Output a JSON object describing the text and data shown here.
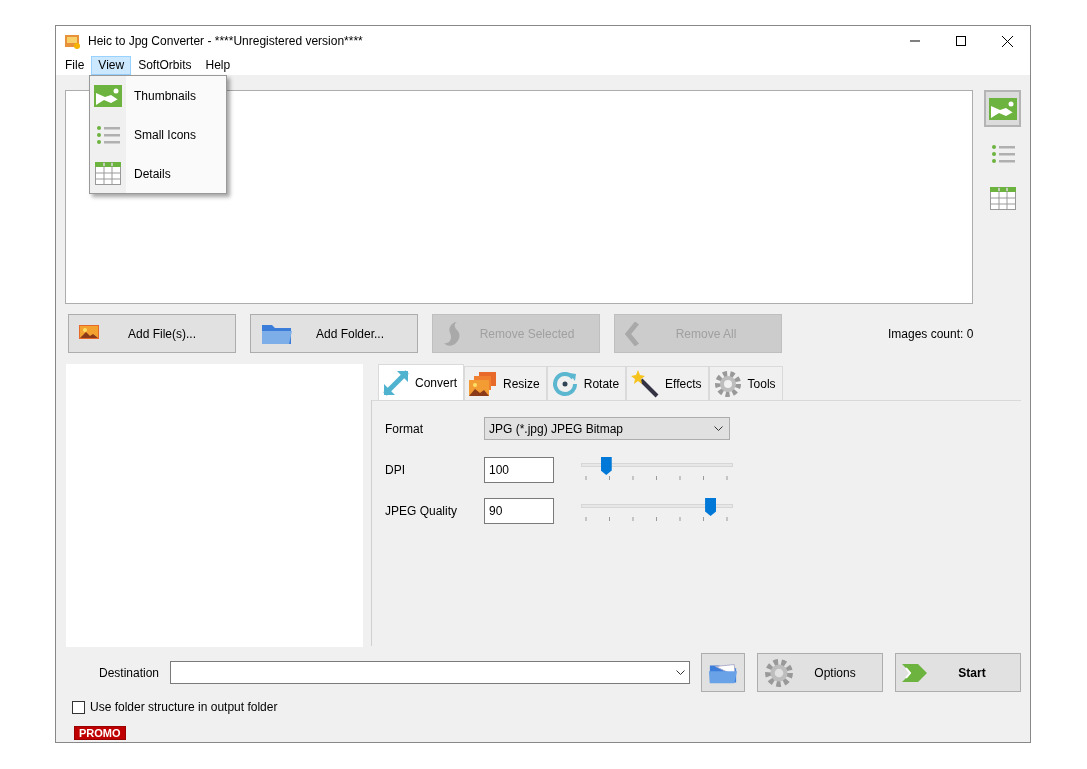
{
  "window": {
    "title": "Heic to Jpg Converter - ****Unregistered version****"
  },
  "menu": [
    {
      "label": "File",
      "selected": false
    },
    {
      "label": "View",
      "selected": true
    },
    {
      "label": "SoftOrbits",
      "selected": false
    },
    {
      "label": "Help",
      "selected": false
    }
  ],
  "view_menu": [
    {
      "label": "Thumbnails"
    },
    {
      "label": "Small Icons"
    },
    {
      "label": "Details"
    }
  ],
  "view_buttons": [
    {
      "selected": true
    },
    {
      "selected": false
    },
    {
      "selected": false
    }
  ],
  "action_buttons": [
    {
      "label": "Add File(s)...",
      "disabled": false
    },
    {
      "label": "Add Folder...",
      "disabled": false
    },
    {
      "label": "Remove Selected",
      "disabled": true
    },
    {
      "label": "Remove All",
      "disabled": true
    }
  ],
  "images_count": "Images count: 0",
  "tabs": [
    {
      "label": "Convert",
      "selected": true
    },
    {
      "label": "Resize",
      "selected": false
    },
    {
      "label": "Rotate",
      "selected": false
    },
    {
      "label": "Effects",
      "selected": false
    },
    {
      "label": "Tools",
      "selected": false
    }
  ],
  "format": {
    "label": "Format",
    "value": "JPG (*.jpg) JPEG Bitmap"
  },
  "sliders": [
    {
      "label": "DPI",
      "value": "100",
      "level": 0.14
    },
    {
      "label": "JPEG Quality",
      "value": "90",
      "level": 0.88
    }
  ],
  "destination": {
    "label": "Destination"
  },
  "bottom_buttons": [
    {
      "label": "Options"
    },
    {
      "label": "Start"
    }
  ],
  "folder_structure": {
    "label": "Use folder structure in output folder",
    "checked": false
  },
  "promo": "PROMO"
}
